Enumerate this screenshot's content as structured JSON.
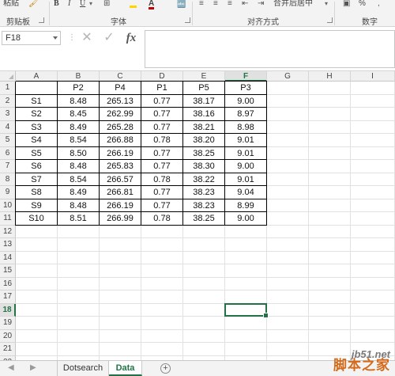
{
  "ribbon": {
    "clipboard_label": "剪贴板",
    "font_label": "字体",
    "alignment_label": "对齐方式",
    "number_label": "数字",
    "paste_label": "粘贴",
    "merge_center_label": "合并后居中",
    "bold": "B",
    "italic": "I",
    "underline": "U",
    "font_color": "A",
    "percent": "%"
  },
  "formula_bar": {
    "name_box": "F18",
    "fx": "fx",
    "value": ""
  },
  "columns": [
    "A",
    "B",
    "C",
    "D",
    "E",
    "F",
    "G",
    "H",
    "I"
  ],
  "rows": [
    "1",
    "2",
    "3",
    "4",
    "5",
    "6",
    "7",
    "8",
    "9",
    "10",
    "11",
    "12",
    "13",
    "14",
    "15",
    "16",
    "17",
    "18",
    "19",
    "20",
    "21",
    "22"
  ],
  "selected_cell": "F18",
  "table": {
    "headers": [
      "",
      "P2",
      "P4",
      "P1",
      "P5",
      "P3"
    ],
    "rows": [
      [
        "S1",
        "8.48",
        "265.13",
        "0.77",
        "38.17",
        "9.00"
      ],
      [
        "S2",
        "8.45",
        "262.99",
        "0.77",
        "38.16",
        "8.97"
      ],
      [
        "S3",
        "8.49",
        "265.28",
        "0.77",
        "38.21",
        "8.98"
      ],
      [
        "S4",
        "8.54",
        "266.88",
        "0.78",
        "38.20",
        "9.01"
      ],
      [
        "S5",
        "8.50",
        "266.19",
        "0.77",
        "38.25",
        "9.01"
      ],
      [
        "S6",
        "8.48",
        "265.83",
        "0.77",
        "38.30",
        "9.00"
      ],
      [
        "S7",
        "8.54",
        "266.57",
        "0.78",
        "38.22",
        "9.01"
      ],
      [
        "S8",
        "8.49",
        "266.81",
        "0.77",
        "38.23",
        "9.04"
      ],
      [
        "S9",
        "8.48",
        "266.19",
        "0.77",
        "38.23",
        "8.99"
      ],
      [
        "S10",
        "8.51",
        "266.99",
        "0.78",
        "38.25",
        "9.00"
      ]
    ]
  },
  "sheets": [
    {
      "name": "Dotsearch",
      "active": false
    },
    {
      "name": "Data",
      "active": true
    }
  ],
  "watermark": {
    "site": "jb51.net",
    "cn": "脚本之家"
  },
  "colors": {
    "accent": "#217346",
    "font_color_bar": "#c00000",
    "highlight_bar": "#ffd400"
  }
}
